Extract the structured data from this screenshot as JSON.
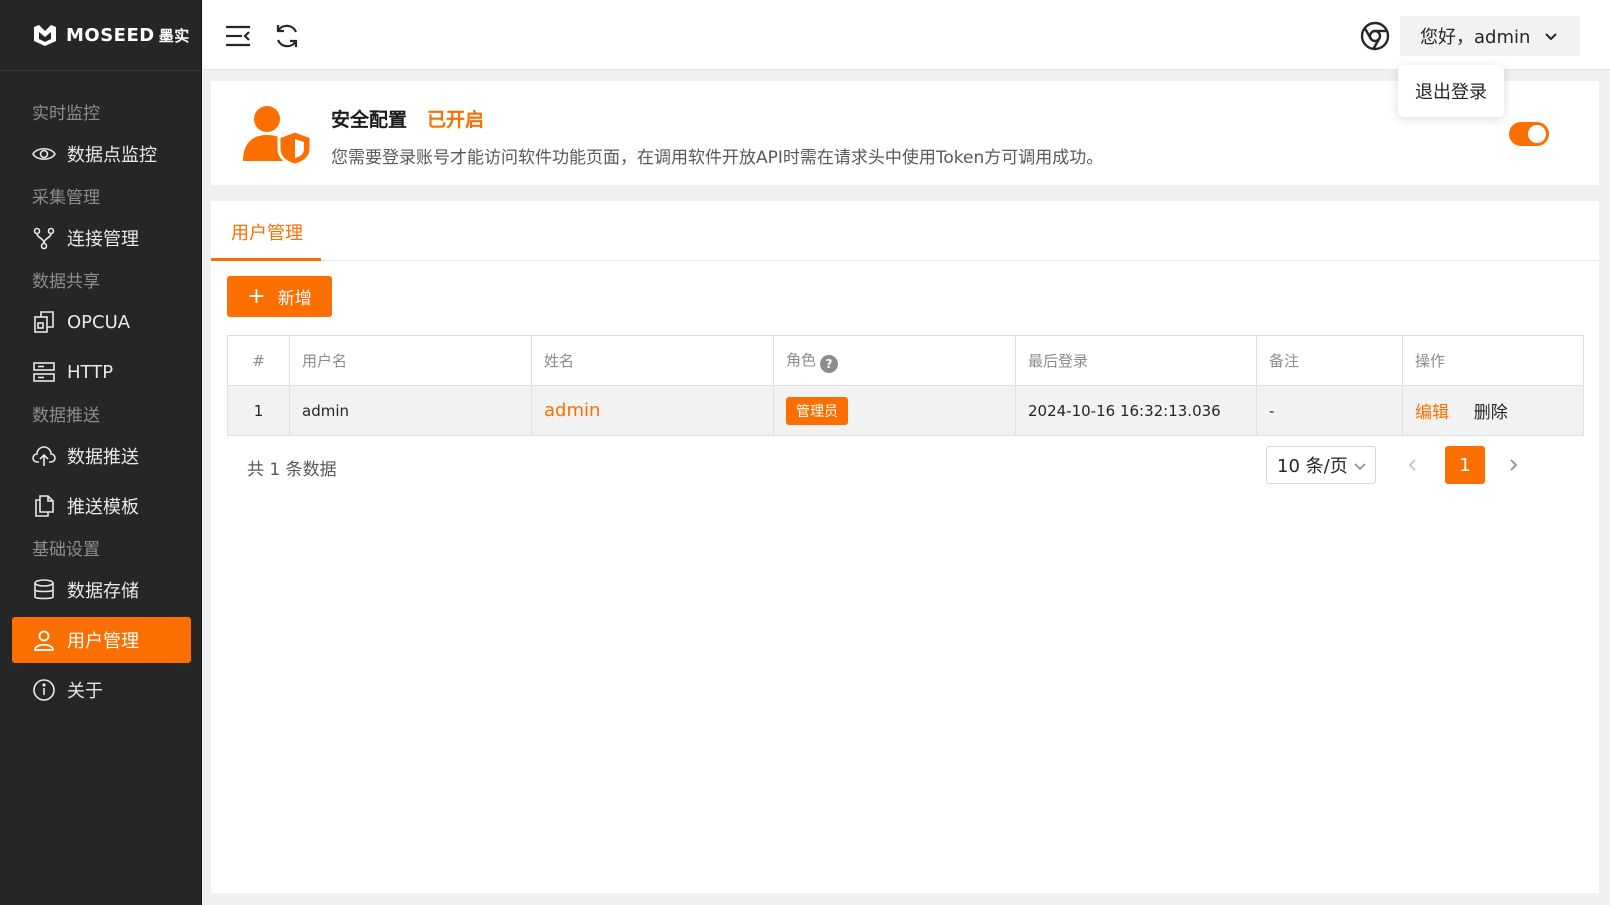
{
  "brand": {
    "name": "MOSEED",
    "cn": "墨实"
  },
  "sidebar": {
    "groups": [
      {
        "title": "实时监控",
        "items": [
          {
            "label": "数据点监控",
            "icon": "eye-icon"
          }
        ]
      },
      {
        "title": "采集管理",
        "items": [
          {
            "label": "连接管理",
            "icon": "fork-icon"
          }
        ]
      },
      {
        "title": "数据共享",
        "items": [
          {
            "label": "OPCUA",
            "icon": "opcua-icon"
          },
          {
            "label": "HTTP",
            "icon": "server-icon"
          }
        ]
      },
      {
        "title": "数据推送",
        "items": [
          {
            "label": "数据推送",
            "icon": "cloud-upload-icon"
          },
          {
            "label": "推送模板",
            "icon": "copy-icon"
          }
        ]
      },
      {
        "title": "基础设置",
        "items": [
          {
            "label": "数据存储",
            "icon": "database-icon"
          },
          {
            "label": "用户管理",
            "icon": "user-icon",
            "active": true
          },
          {
            "label": "关于",
            "icon": "info-icon"
          }
        ]
      }
    ]
  },
  "header": {
    "greeting": "您好，admin",
    "dropdown": {
      "logout": "退出登录"
    }
  },
  "security": {
    "title": "安全配置",
    "status": "已开启",
    "description": "您需要登录账号才能访问软件功能页面，在调用软件开放API时需在请求头中使用Token方可调用成功。",
    "enabled": true
  },
  "main": {
    "tab": "用户管理",
    "add_button": "新增",
    "table": {
      "columns": [
        "#",
        "用户名",
        "姓名",
        "角色",
        "最后登录",
        "备注",
        "操作"
      ],
      "rows": [
        {
          "index": "1",
          "username": "admin",
          "name": "admin",
          "role": "管理员",
          "last_login": "2024-10-16 16:32:13.036",
          "remark": "-",
          "edit": "编辑",
          "delete": "删除"
        }
      ]
    },
    "pagination": {
      "total_text": "共 1 条数据",
      "page_size": "10 条/页",
      "current_page": "1"
    }
  },
  "colors": {
    "accent": "#fa6f00",
    "sidebar_bg": "#262626"
  }
}
